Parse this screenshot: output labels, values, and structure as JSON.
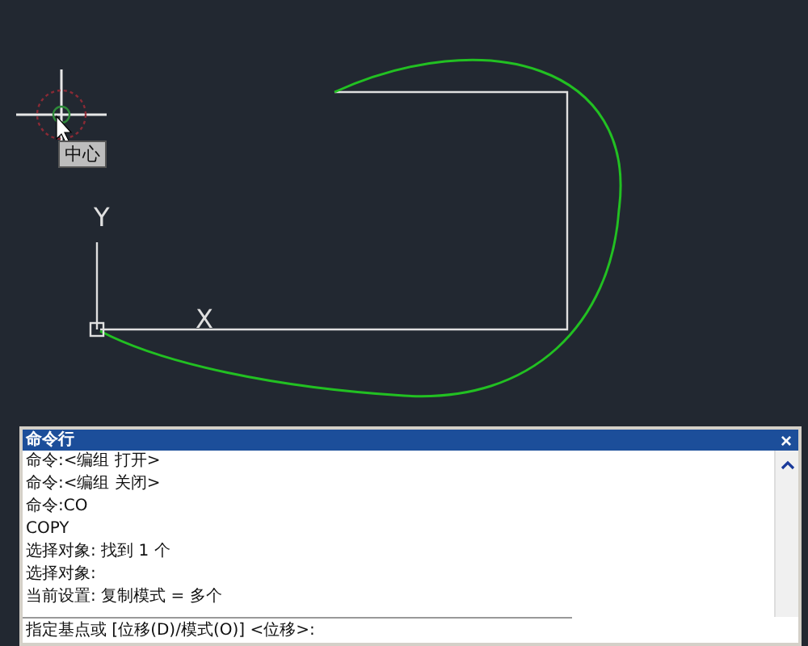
{
  "canvas": {
    "tooltip": "中心",
    "ucs": {
      "y_label": "Y",
      "x_label": "X"
    }
  },
  "command_window": {
    "title": "命令行",
    "close": "×",
    "history": [
      "命令:<编组 打开>",
      "命令:<编组 关闭>",
      "命令:CO",
      "COPY",
      "选择对象: 找到 1 个",
      "选择对象:",
      "当前设置:  复制模式 = 多个"
    ],
    "prompt": "指定基点或 [位移(D)/模式(O)] <位移>:"
  }
}
